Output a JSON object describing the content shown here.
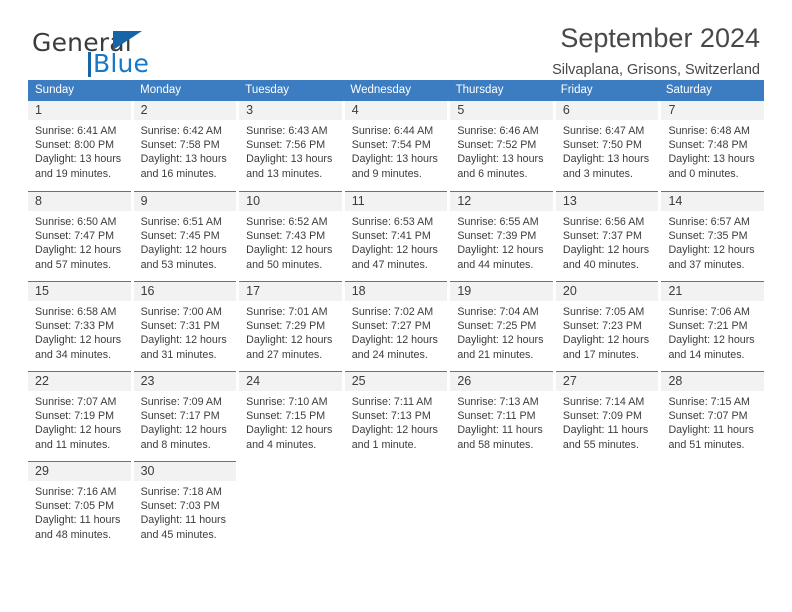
{
  "brand": {
    "name_top": "General",
    "name_bottom": "Blue",
    "accent_color": "#1878c8",
    "triangle_color": "#1565a8"
  },
  "header": {
    "title": "September 2024",
    "subtitle": "Silvaplana, Grisons, Switzerland"
  },
  "theme": {
    "header_band": "#3b7dc0",
    "day_band": "#f2f2f2",
    "text": "#3c3c3c"
  },
  "weekdays": [
    "Sunday",
    "Monday",
    "Tuesday",
    "Wednesday",
    "Thursday",
    "Friday",
    "Saturday"
  ],
  "weeks": [
    [
      {
        "day": "1",
        "sunrise": "Sunrise: 6:41 AM",
        "sunset": "Sunset: 8:00 PM",
        "daylight_line1": "Daylight: 13 hours",
        "daylight_line2": "and 19 minutes."
      },
      {
        "day": "2",
        "sunrise": "Sunrise: 6:42 AM",
        "sunset": "Sunset: 7:58 PM",
        "daylight_line1": "Daylight: 13 hours",
        "daylight_line2": "and 16 minutes."
      },
      {
        "day": "3",
        "sunrise": "Sunrise: 6:43 AM",
        "sunset": "Sunset: 7:56 PM",
        "daylight_line1": "Daylight: 13 hours",
        "daylight_line2": "and 13 minutes."
      },
      {
        "day": "4",
        "sunrise": "Sunrise: 6:44 AM",
        "sunset": "Sunset: 7:54 PM",
        "daylight_line1": "Daylight: 13 hours",
        "daylight_line2": "and 9 minutes."
      },
      {
        "day": "5",
        "sunrise": "Sunrise: 6:46 AM",
        "sunset": "Sunset: 7:52 PM",
        "daylight_line1": "Daylight: 13 hours",
        "daylight_line2": "and 6 minutes."
      },
      {
        "day": "6",
        "sunrise": "Sunrise: 6:47 AM",
        "sunset": "Sunset: 7:50 PM",
        "daylight_line1": "Daylight: 13 hours",
        "daylight_line2": "and 3 minutes."
      },
      {
        "day": "7",
        "sunrise": "Sunrise: 6:48 AM",
        "sunset": "Sunset: 7:48 PM",
        "daylight_line1": "Daylight: 13 hours",
        "daylight_line2": "and 0 minutes."
      }
    ],
    [
      {
        "day": "8",
        "sunrise": "Sunrise: 6:50 AM",
        "sunset": "Sunset: 7:47 PM",
        "daylight_line1": "Daylight: 12 hours",
        "daylight_line2": "and 57 minutes."
      },
      {
        "day": "9",
        "sunrise": "Sunrise: 6:51 AM",
        "sunset": "Sunset: 7:45 PM",
        "daylight_line1": "Daylight: 12 hours",
        "daylight_line2": "and 53 minutes."
      },
      {
        "day": "10",
        "sunrise": "Sunrise: 6:52 AM",
        "sunset": "Sunset: 7:43 PM",
        "daylight_line1": "Daylight: 12 hours",
        "daylight_line2": "and 50 minutes."
      },
      {
        "day": "11",
        "sunrise": "Sunrise: 6:53 AM",
        "sunset": "Sunset: 7:41 PM",
        "daylight_line1": "Daylight: 12 hours",
        "daylight_line2": "and 47 minutes."
      },
      {
        "day": "12",
        "sunrise": "Sunrise: 6:55 AM",
        "sunset": "Sunset: 7:39 PM",
        "daylight_line1": "Daylight: 12 hours",
        "daylight_line2": "and 44 minutes."
      },
      {
        "day": "13",
        "sunrise": "Sunrise: 6:56 AM",
        "sunset": "Sunset: 7:37 PM",
        "daylight_line1": "Daylight: 12 hours",
        "daylight_line2": "and 40 minutes."
      },
      {
        "day": "14",
        "sunrise": "Sunrise: 6:57 AM",
        "sunset": "Sunset: 7:35 PM",
        "daylight_line1": "Daylight: 12 hours",
        "daylight_line2": "and 37 minutes."
      }
    ],
    [
      {
        "day": "15",
        "sunrise": "Sunrise: 6:58 AM",
        "sunset": "Sunset: 7:33 PM",
        "daylight_line1": "Daylight: 12 hours",
        "daylight_line2": "and 34 minutes."
      },
      {
        "day": "16",
        "sunrise": "Sunrise: 7:00 AM",
        "sunset": "Sunset: 7:31 PM",
        "daylight_line1": "Daylight: 12 hours",
        "daylight_line2": "and 31 minutes."
      },
      {
        "day": "17",
        "sunrise": "Sunrise: 7:01 AM",
        "sunset": "Sunset: 7:29 PM",
        "daylight_line1": "Daylight: 12 hours",
        "daylight_line2": "and 27 minutes."
      },
      {
        "day": "18",
        "sunrise": "Sunrise: 7:02 AM",
        "sunset": "Sunset: 7:27 PM",
        "daylight_line1": "Daylight: 12 hours",
        "daylight_line2": "and 24 minutes."
      },
      {
        "day": "19",
        "sunrise": "Sunrise: 7:04 AM",
        "sunset": "Sunset: 7:25 PM",
        "daylight_line1": "Daylight: 12 hours",
        "daylight_line2": "and 21 minutes."
      },
      {
        "day": "20",
        "sunrise": "Sunrise: 7:05 AM",
        "sunset": "Sunset: 7:23 PM",
        "daylight_line1": "Daylight: 12 hours",
        "daylight_line2": "and 17 minutes."
      },
      {
        "day": "21",
        "sunrise": "Sunrise: 7:06 AM",
        "sunset": "Sunset: 7:21 PM",
        "daylight_line1": "Daylight: 12 hours",
        "daylight_line2": "and 14 minutes."
      }
    ],
    [
      {
        "day": "22",
        "sunrise": "Sunrise: 7:07 AM",
        "sunset": "Sunset: 7:19 PM",
        "daylight_line1": "Daylight: 12 hours",
        "daylight_line2": "and 11 minutes."
      },
      {
        "day": "23",
        "sunrise": "Sunrise: 7:09 AM",
        "sunset": "Sunset: 7:17 PM",
        "daylight_line1": "Daylight: 12 hours",
        "daylight_line2": "and 8 minutes."
      },
      {
        "day": "24",
        "sunrise": "Sunrise: 7:10 AM",
        "sunset": "Sunset: 7:15 PM",
        "daylight_line1": "Daylight: 12 hours",
        "daylight_line2": "and 4 minutes."
      },
      {
        "day": "25",
        "sunrise": "Sunrise: 7:11 AM",
        "sunset": "Sunset: 7:13 PM",
        "daylight_line1": "Daylight: 12 hours",
        "daylight_line2": "and 1 minute."
      },
      {
        "day": "26",
        "sunrise": "Sunrise: 7:13 AM",
        "sunset": "Sunset: 7:11 PM",
        "daylight_line1": "Daylight: 11 hours",
        "daylight_line2": "and 58 minutes."
      },
      {
        "day": "27",
        "sunrise": "Sunrise: 7:14 AM",
        "sunset": "Sunset: 7:09 PM",
        "daylight_line1": "Daylight: 11 hours",
        "daylight_line2": "and 55 minutes."
      },
      {
        "day": "28",
        "sunrise": "Sunrise: 7:15 AM",
        "sunset": "Sunset: 7:07 PM",
        "daylight_line1": "Daylight: 11 hours",
        "daylight_line2": "and 51 minutes."
      }
    ],
    [
      {
        "day": "29",
        "sunrise": "Sunrise: 7:16 AM",
        "sunset": "Sunset: 7:05 PM",
        "daylight_line1": "Daylight: 11 hours",
        "daylight_line2": "and 48 minutes."
      },
      {
        "day": "30",
        "sunrise": "Sunrise: 7:18 AM",
        "sunset": "Sunset: 7:03 PM",
        "daylight_line1": "Daylight: 11 hours",
        "daylight_line2": "and 45 minutes."
      },
      {
        "day": "",
        "sunrise": "",
        "sunset": "",
        "daylight_line1": "",
        "daylight_line2": ""
      },
      {
        "day": "",
        "sunrise": "",
        "sunset": "",
        "daylight_line1": "",
        "daylight_line2": ""
      },
      {
        "day": "",
        "sunrise": "",
        "sunset": "",
        "daylight_line1": "",
        "daylight_line2": ""
      },
      {
        "day": "",
        "sunrise": "",
        "sunset": "",
        "daylight_line1": "",
        "daylight_line2": ""
      },
      {
        "day": "",
        "sunrise": "",
        "sunset": "",
        "daylight_line1": "",
        "daylight_line2": ""
      }
    ]
  ]
}
